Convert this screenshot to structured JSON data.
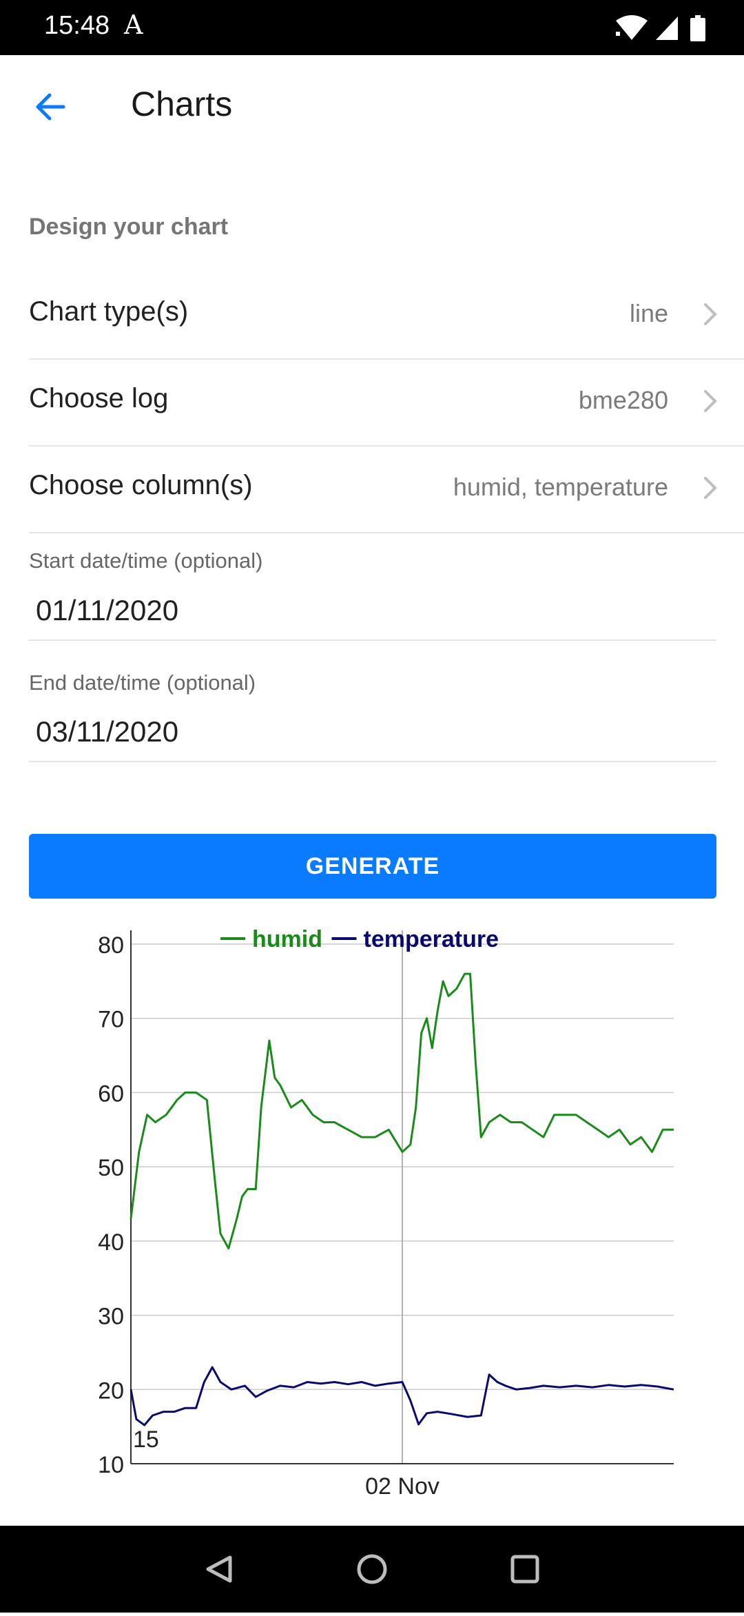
{
  "status_bar": {
    "time": "15:48",
    "indicator": "A"
  },
  "app_bar": {
    "title": "Charts",
    "back_icon": "arrow-left-icon"
  },
  "section": {
    "label": "Design your chart"
  },
  "settings": [
    {
      "label": "Chart type(s)",
      "value": "line"
    },
    {
      "label": "Choose log",
      "value": "bme280"
    },
    {
      "label": "Choose column(s)",
      "value": "humid, temperature"
    }
  ],
  "fields": {
    "start": {
      "label": "Start date/time (optional)",
      "value": "01/11/2020"
    },
    "end": {
      "label": "End date/time (optional)",
      "value": "03/11/2020"
    }
  },
  "generate_label": "GENERATE",
  "colors": {
    "accent": "#0a7aff",
    "humid": "#1a8a1a",
    "temperature": "#0a0a6e"
  },
  "chart_data": {
    "type": "line",
    "ylim": [
      10,
      80
    ],
    "yticks": [
      "80",
      "70",
      "60",
      "50",
      "40",
      "30",
      "20",
      "10"
    ],
    "xticks": [
      {
        "x": 1.0,
        "label": "02 Nov"
      }
    ],
    "xlim": [
      0,
      2.0
    ],
    "annotation": "15",
    "legend_position": "top",
    "series": [
      {
        "name": "humid",
        "x": [
          0,
          0.03,
          0.06,
          0.09,
          0.13,
          0.17,
          0.2,
          0.24,
          0.28,
          0.31,
          0.33,
          0.36,
          0.39,
          0.41,
          0.43,
          0.46,
          0.48,
          0.51,
          0.53,
          0.55,
          0.59,
          0.63,
          0.67,
          0.71,
          0.75,
          0.8,
          0.85,
          0.9,
          0.95,
          1.0,
          1.03,
          1.05,
          1.07,
          1.09,
          1.11,
          1.13,
          1.15,
          1.17,
          1.2,
          1.23,
          1.25,
          1.27,
          1.29,
          1.32,
          1.36,
          1.4,
          1.44,
          1.48,
          1.52,
          1.56,
          1.6,
          1.64,
          1.68,
          1.72,
          1.76,
          1.8,
          1.84,
          1.88,
          1.92,
          1.96,
          2.0
        ],
        "values": [
          43,
          52,
          57,
          56,
          57,
          59,
          60,
          60,
          59,
          48,
          41,
          39,
          43,
          46,
          47,
          47,
          58,
          67,
          62,
          61,
          58,
          59,
          57,
          56,
          56,
          55,
          54,
          54,
          55,
          52,
          53,
          58,
          68,
          70,
          66,
          71,
          75,
          73,
          74,
          76,
          76,
          64,
          54,
          56,
          57,
          56,
          56,
          55,
          54,
          57,
          57,
          57,
          56,
          55,
          54,
          55,
          53,
          54,
          52,
          55,
          55
        ]
      },
      {
        "name": "temperature",
        "x": [
          0,
          0.02,
          0.05,
          0.08,
          0.12,
          0.16,
          0.2,
          0.24,
          0.27,
          0.3,
          0.33,
          0.37,
          0.42,
          0.46,
          0.5,
          0.55,
          0.6,
          0.65,
          0.7,
          0.75,
          0.8,
          0.85,
          0.9,
          0.95,
          1.0,
          1.03,
          1.06,
          1.09,
          1.13,
          1.18,
          1.24,
          1.29,
          1.32,
          1.35,
          1.38,
          1.42,
          1.47,
          1.52,
          1.58,
          1.64,
          1.7,
          1.76,
          1.82,
          1.88,
          1.94,
          2.0
        ],
        "values": [
          20,
          16,
          15.2,
          16.5,
          17,
          17,
          17.5,
          17.5,
          21,
          23,
          21,
          20,
          20.5,
          19,
          19.8,
          20.5,
          20.3,
          21,
          20.8,
          21,
          20.7,
          21,
          20.5,
          20.8,
          21,
          18.5,
          15.3,
          16.8,
          17,
          16.7,
          16.3,
          16.5,
          22,
          21,
          20.5,
          20,
          20.2,
          20.5,
          20.3,
          20.5,
          20.3,
          20.6,
          20.4,
          20.6,
          20.4,
          20
        ]
      }
    ]
  }
}
